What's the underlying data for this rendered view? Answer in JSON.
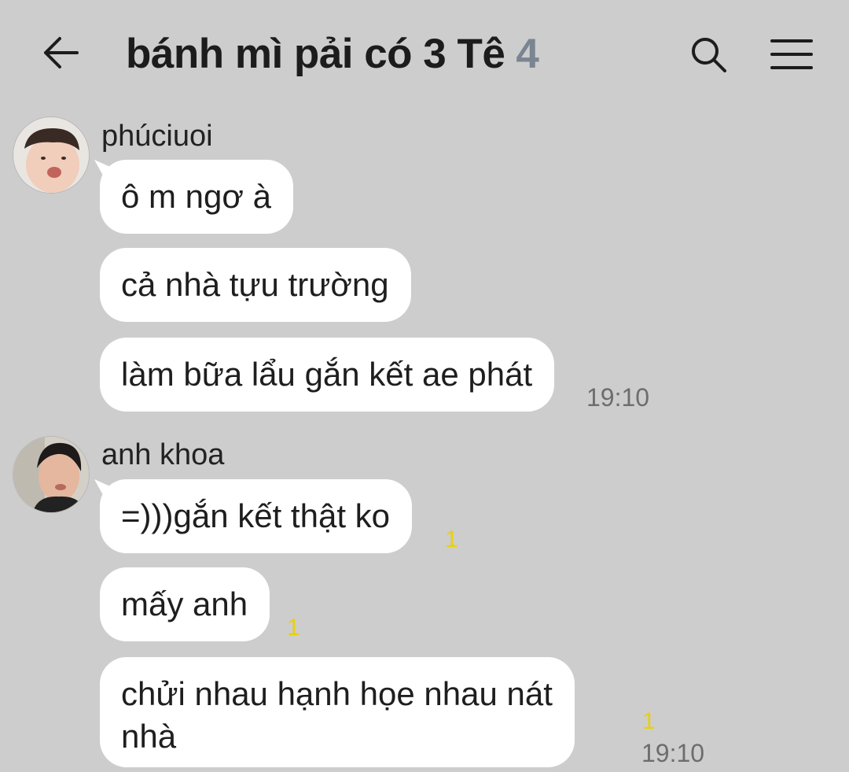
{
  "header": {
    "title": "bánh mì pải có 3 Tê",
    "member_count": "4",
    "back_icon": "arrow-left-icon",
    "search_icon": "search-icon",
    "menu_icon": "hamburger-menu-icon"
  },
  "colors": {
    "background": "#cdcdcd",
    "bubble": "#ffffff",
    "member_count": "#7a8592",
    "unread": "#e8d10a",
    "time": "#6d6d6d"
  },
  "groups": [
    {
      "sender": "phúciuoi",
      "messages": [
        {
          "text": "ô m ngơ à",
          "unread": "",
          "time": ""
        },
        {
          "text": "cả nhà tựu trường",
          "unread": "",
          "time": ""
        },
        {
          "text": "làm bữa lẩu gắn kết ae phát",
          "unread": "",
          "time": "19:10"
        }
      ]
    },
    {
      "sender": "anh khoa",
      "messages": [
        {
          "text": "=)))gắn kết thật ko",
          "unread": "1",
          "time": ""
        },
        {
          "text": "mấy anh",
          "unread": "1",
          "time": ""
        },
        {
          "text_line1": "chửi nhau hạnh họe nhau nát",
          "text_line2": "nhà",
          "unread": "1",
          "time": "19:10"
        }
      ]
    }
  ]
}
